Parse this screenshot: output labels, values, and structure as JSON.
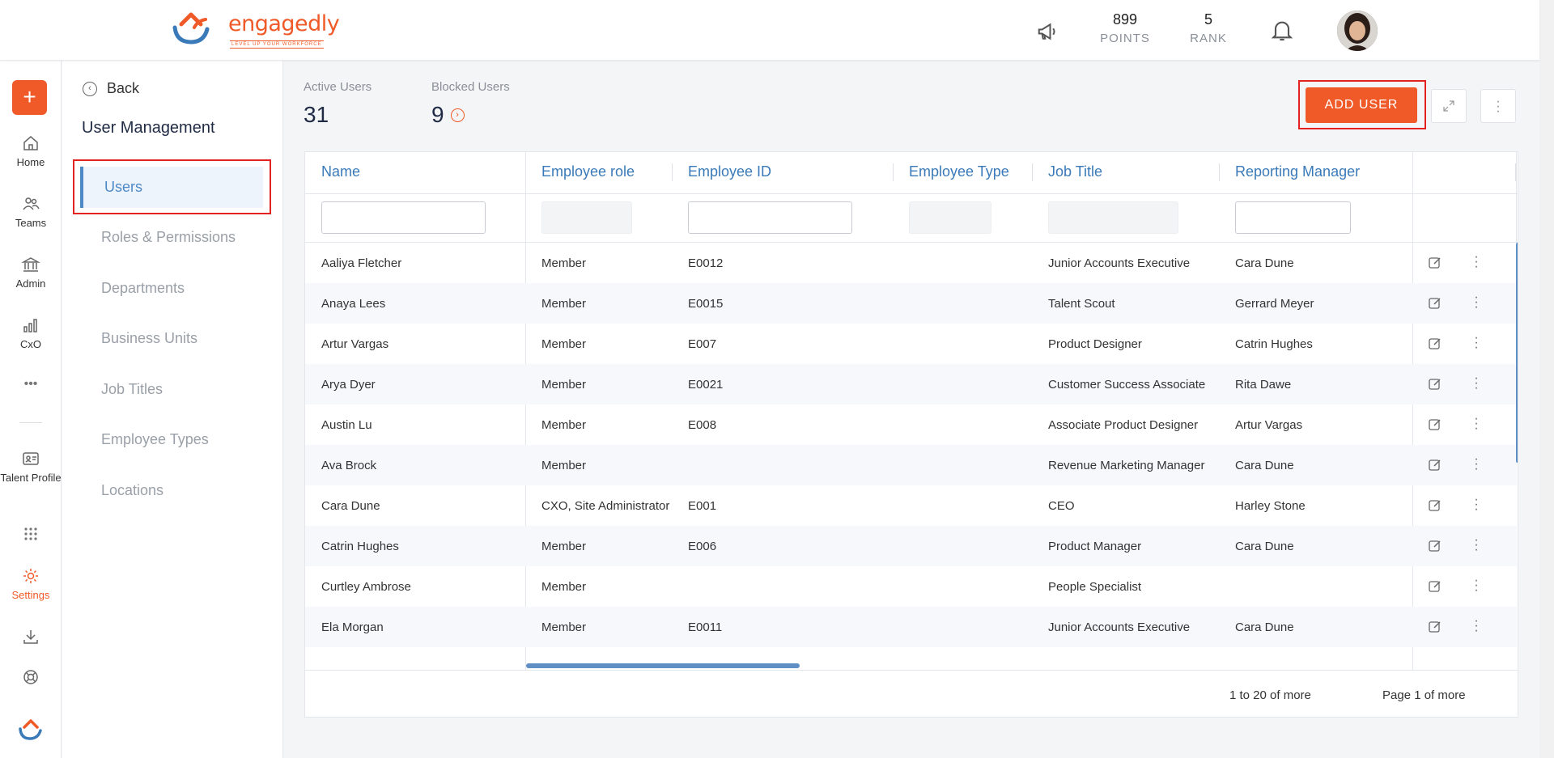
{
  "header": {
    "logo_text": "engagedly",
    "logo_tagline": "LEVEL UP YOUR WORKFORCE",
    "points_value": "899",
    "points_label": "POINTS",
    "rank_value": "5",
    "rank_label": "RANK"
  },
  "rail": {
    "items": [
      {
        "label": "Home",
        "icon": "home-icon"
      },
      {
        "label": "Teams",
        "icon": "teams-icon"
      },
      {
        "label": "Admin",
        "icon": "bank-icon"
      },
      {
        "label": "CxO",
        "icon": "bar-chart-icon"
      },
      {
        "label": "Talent Profile",
        "icon": "id-card-icon"
      },
      {
        "label": "Settings",
        "icon": "gear-icon"
      }
    ],
    "active_color": "#f05a28"
  },
  "subnav": {
    "back_label": "Back",
    "title": "User Management",
    "items": [
      "Users",
      "Roles & Permissions",
      "Departments",
      "Business Units",
      "Job Titles",
      "Employee Types",
      "Locations"
    ],
    "active_item": "Users"
  },
  "summary": {
    "active_label": "Active Users",
    "active_value": "31",
    "blocked_label": "Blocked Users",
    "blocked_value": "9"
  },
  "toolbar": {
    "add_user_label": "ADD USER",
    "accent": "#f05a28"
  },
  "grid": {
    "columns": [
      "Name",
      "Employee role",
      "Employee ID",
      "Employee Type",
      "Job Title",
      "Reporting Manager"
    ],
    "rows": [
      {
        "name": "Aaliya Fletcher",
        "role": "Member",
        "id": "E0012",
        "type": "",
        "title": "Junior Accounts Executive",
        "manager": "Cara Dune"
      },
      {
        "name": "Anaya Lees",
        "role": "Member",
        "id": "E0015",
        "type": "",
        "title": "Talent Scout",
        "manager": "Gerrard Meyer"
      },
      {
        "name": "Artur Vargas",
        "role": "Member",
        "id": "E007",
        "type": "",
        "title": "Product Designer",
        "manager": "Catrin Hughes"
      },
      {
        "name": "Arya Dyer",
        "role": "Member",
        "id": "E0021",
        "type": "",
        "title": "Customer Success Associate",
        "manager": "Rita Dawe"
      },
      {
        "name": "Austin Lu",
        "role": "Member",
        "id": "E008",
        "type": "",
        "title": "Associate Product Designer",
        "manager": "Artur Vargas"
      },
      {
        "name": "Ava Brock",
        "role": "Member",
        "id": "",
        "type": "",
        "title": "Revenue Marketing Manager",
        "manager": "Cara Dune"
      },
      {
        "name": "Cara Dune",
        "role": "CXO, Site Administrator",
        "id": "E001",
        "type": "",
        "title": "CEO",
        "manager": "Harley Stone"
      },
      {
        "name": "Catrin Hughes",
        "role": "Member",
        "id": "E006",
        "type": "",
        "title": "Product Manager",
        "manager": "Cara Dune"
      },
      {
        "name": "Curtley Ambrose",
        "role": "Member",
        "id": "",
        "type": "",
        "title": "People Specialist",
        "manager": ""
      },
      {
        "name": "Ela Morgan",
        "role": "Member",
        "id": "E0011",
        "type": "",
        "title": "Junior Accounts Executive",
        "manager": "Cara Dune"
      }
    ],
    "footer_range": "1 to 20 of more",
    "footer_page": "Page 1 of more"
  }
}
